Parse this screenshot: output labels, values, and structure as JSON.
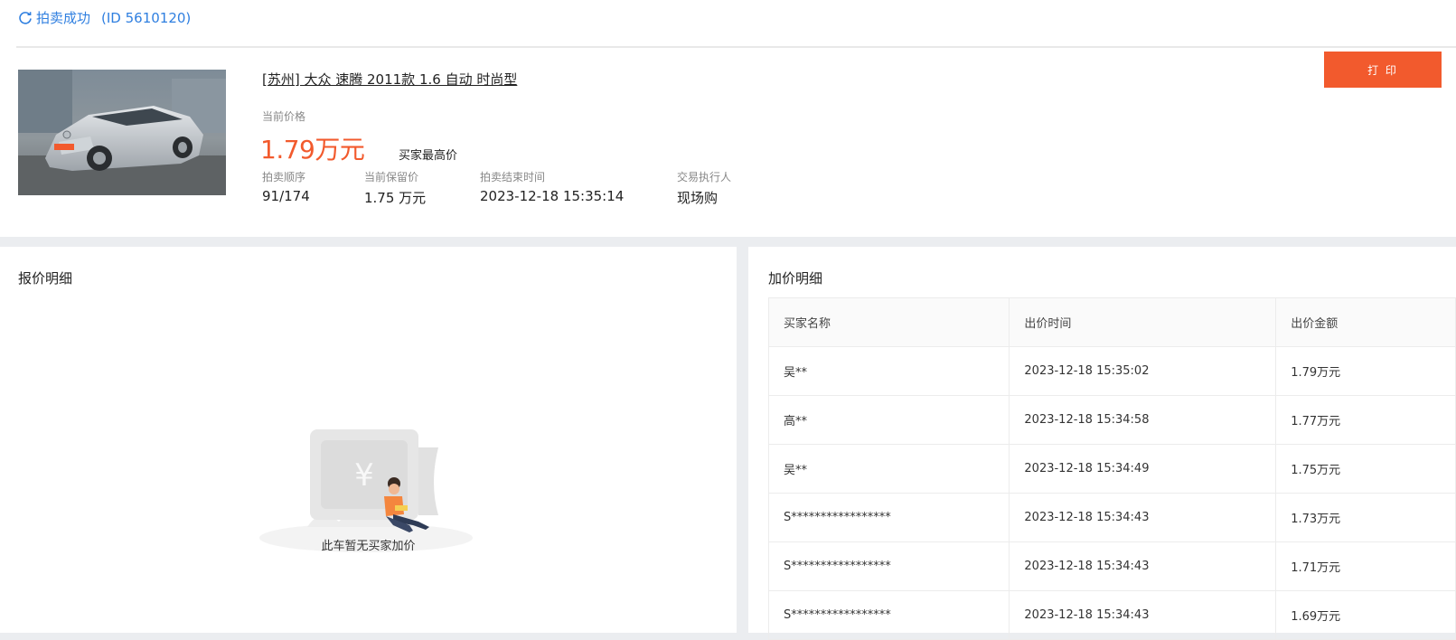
{
  "header": {
    "status": "拍卖成功",
    "id_text": "(ID 5610120)"
  },
  "car": {
    "title": "[苏州] 大众 速腾 2011款 1.6 自动 时尚型",
    "price_label": "当前价格",
    "price_value": "1.79万元",
    "price_note": "买家最高价",
    "meta": [
      {
        "label": "拍卖顺序",
        "value": "91/174"
      },
      {
        "label": "当前保留价",
        "value": "1.75 万元"
      },
      {
        "label": "拍卖结束时间",
        "value": "2023-12-18 15:35:14"
      },
      {
        "label": "交易执行人",
        "value": "现场购"
      }
    ]
  },
  "actions": {
    "print_label": "打 印"
  },
  "quote_panel": {
    "title": "报价明细",
    "empty_text": "此车暂无买家加价"
  },
  "bid_panel": {
    "title": "加价明细",
    "columns": [
      "买家名称",
      "出价时间",
      "出价金额"
    ],
    "rows": [
      [
        "吴**",
        "2023-12-18 15:35:02",
        "1.79万元"
      ],
      [
        "高**",
        "2023-12-18 15:34:58",
        "1.77万元"
      ],
      [
        "吴**",
        "2023-12-18 15:34:49",
        "1.75万元"
      ],
      [
        "S*****************",
        "2023-12-18 15:34:43",
        "1.73万元"
      ],
      [
        "S*****************",
        "2023-12-18 15:34:43",
        "1.71万元"
      ],
      [
        "S*****************",
        "2023-12-18 15:34:43",
        "1.69万元"
      ]
    ]
  },
  "colors": {
    "accent_orange": "#f25a2d",
    "link_blue": "#2f7fe0",
    "page_gray": "#ebedf0"
  }
}
